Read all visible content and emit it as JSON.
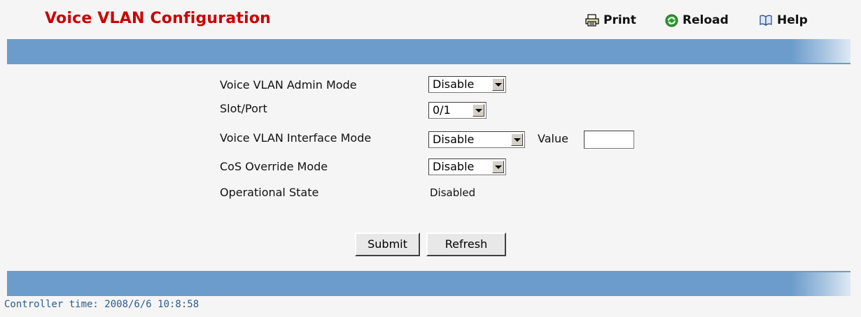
{
  "header": {
    "title": "Voice VLAN Configuration",
    "print_label": "Print",
    "reload_label": "Reload",
    "help_label": "Help"
  },
  "form": {
    "admin_mode_label": "Voice VLAN Admin Mode",
    "admin_mode_value": "Disable",
    "slot_port_label": "Slot/Port",
    "slot_port_value": "0/1",
    "interface_mode_label": "Voice VLAN Interface Mode",
    "interface_mode_value": "Disable",
    "value_label": "Value",
    "value_input": "",
    "cos_override_label": "CoS Override Mode",
    "cos_override_value": "Disable",
    "operational_state_label": "Operational State",
    "operational_state_value": "Disabled"
  },
  "buttons": {
    "submit_label": "Submit",
    "refresh_label": "Refresh"
  },
  "footer": {
    "controller_time": "Controller time: 2008/6/6 10:8:58"
  },
  "colors": {
    "title": "#cc0000",
    "band": "#6c9ccb",
    "footer_text": "#2a5b8d"
  }
}
